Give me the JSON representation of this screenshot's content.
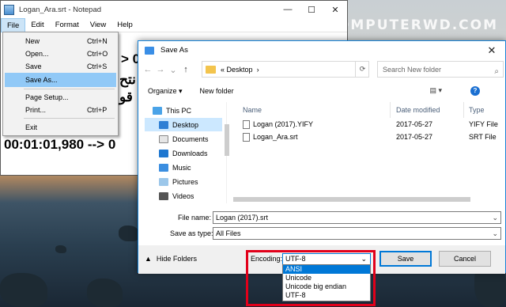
{
  "brand": "COMPUTERWD.COM",
  "notepad": {
    "title": "Logan_Ara.srt - Notepad",
    "controls": {
      "min": "—",
      "max": "☐",
      "close": "✕"
    },
    "menu": [
      "File",
      "Edit",
      "Format",
      "View",
      "Help"
    ],
    "text_line": "00:01:01,980 --> 0",
    "fragments": [
      "> 0",
      "نتح",
      "قو"
    ]
  },
  "file_menu": [
    {
      "label": "New",
      "shortcut": "Ctrl+N"
    },
    {
      "label": "Open...",
      "shortcut": "Ctrl+O"
    },
    {
      "label": "Save",
      "shortcut": "Ctrl+S"
    },
    {
      "label": "Save As...",
      "shortcut": ""
    },
    {
      "label": "Page Setup...",
      "shortcut": ""
    },
    {
      "label": "Print...",
      "shortcut": "Ctrl+P"
    },
    {
      "label": "Exit",
      "shortcut": ""
    }
  ],
  "dialog": {
    "title": "Save As",
    "close": "✕",
    "nav": {
      "back": "←",
      "forward": "→",
      "up_dd": "⌄",
      "up": "↑"
    },
    "address": {
      "prefix": "«",
      "location": "Desktop",
      "chevron": "›",
      "refresh": "⟳"
    },
    "search_placeholder": "Search New folder",
    "search_icon": "⌕",
    "toolbar": {
      "organize": "Organize ▾",
      "new_folder": "New folder",
      "view": "▤ ▾",
      "help": "?"
    },
    "nav_items": [
      "This PC",
      "Desktop",
      "Documents",
      "Downloads",
      "Music",
      "Pictures",
      "Videos"
    ],
    "columns": {
      "name": "Name",
      "date": "Date modified",
      "type": "Type"
    },
    "files": [
      {
        "name": "Logan (2017).YIFY",
        "date": "2017-05-27",
        "type": "YIFY File"
      },
      {
        "name": "Logan_Ara.srt",
        "date": "2017-05-27",
        "type": "SRT File"
      }
    ],
    "file_name_label": "File name:",
    "file_name": "Logan (2017).srt",
    "save_type_label": "Save as type:",
    "save_type": "All Files",
    "hide_folders": "Hide Folders",
    "hide_icon": "▲",
    "encoding_label": "Encoding:",
    "encoding": "UTF-8",
    "encoding_options": [
      "ANSI",
      "Unicode",
      "Unicode big endian",
      "UTF-8"
    ],
    "save": "Save",
    "cancel": "Cancel"
  },
  "colors": {
    "selection": "#0078d7",
    "highlight": "#e2001a",
    "menu_hover": "#91c9f7"
  }
}
